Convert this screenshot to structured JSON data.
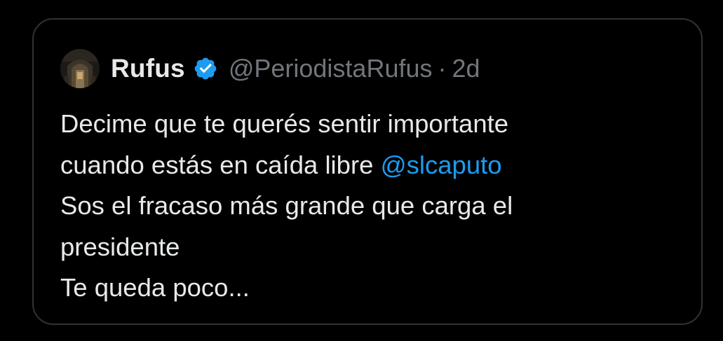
{
  "tweet": {
    "author": {
      "name": "Rufus",
      "handle": "@PeriodistaRufus",
      "separator": "·",
      "time": "2d",
      "avatar_icon": "avatar-photo",
      "verified_icon": "verified-badge-icon"
    },
    "text_lines": [
      {
        "text": "Decime que te querés sentir importante"
      },
      {
        "text": "cuando estás en caída libre ",
        "mention": "@slcaputo"
      },
      {
        "text": "Sos el fracaso más grande que carga el"
      },
      {
        "text": "presidente"
      },
      {
        "text": "Te queda poco..."
      }
    ]
  },
  "colors": {
    "background": "#000000",
    "border": "#2f3336",
    "primary_text": "#e7e9ea",
    "secondary_text": "#71767b",
    "accent": "#1d9bf0"
  }
}
